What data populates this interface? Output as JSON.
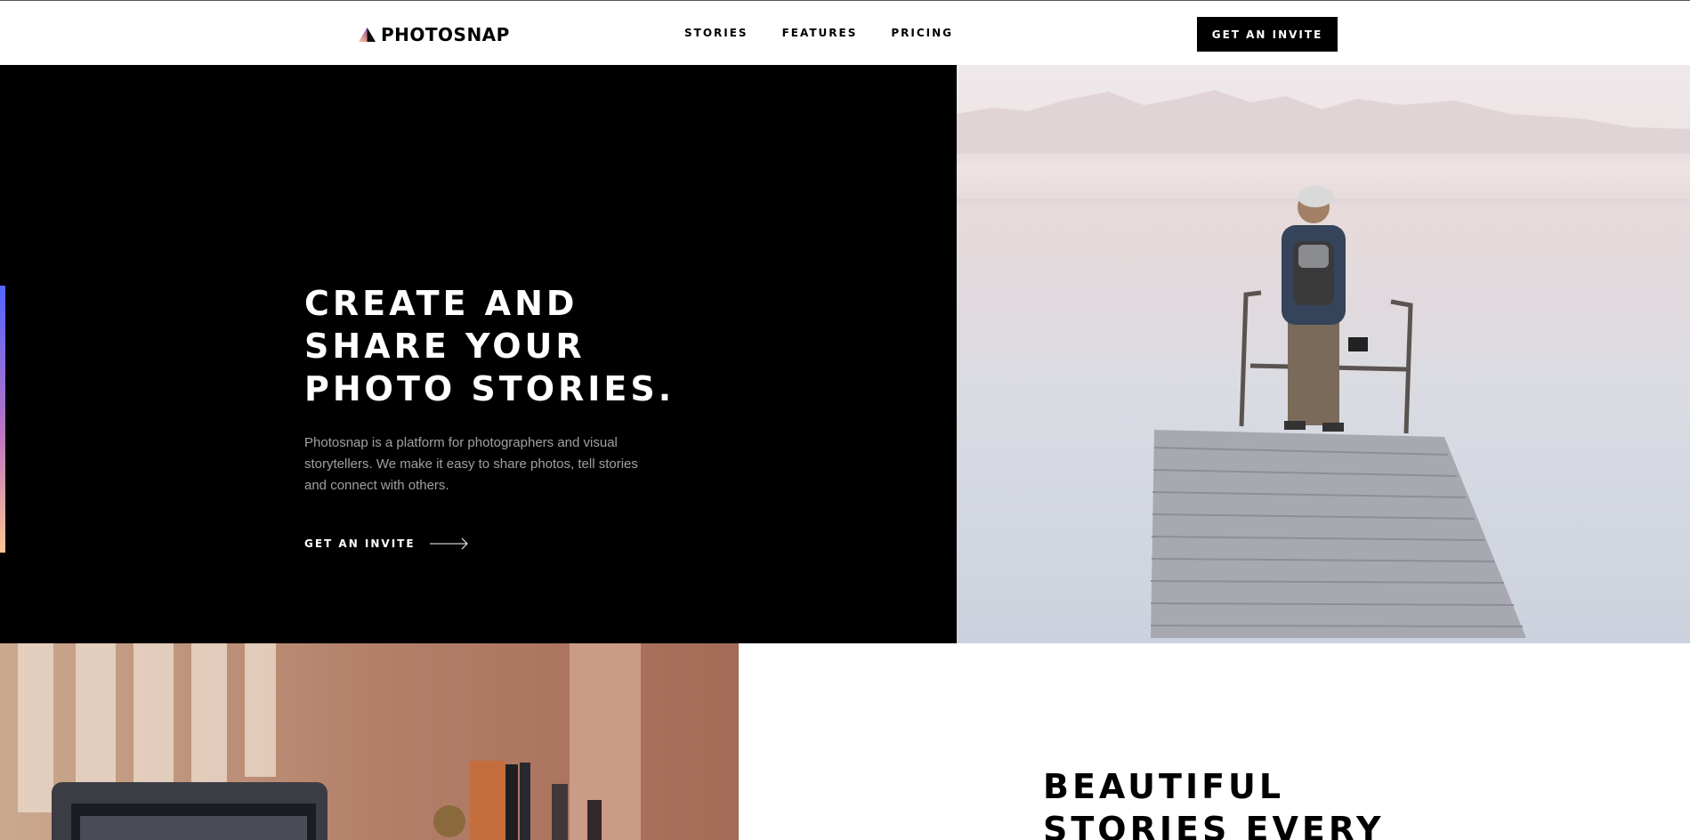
{
  "header": {
    "brand": "PHOTOSNAP",
    "logo_icon": "triangle-logo-icon",
    "nav": [
      {
        "label": "STORIES"
      },
      {
        "label": "FEATURES"
      },
      {
        "label": "PRICING"
      }
    ],
    "cta_label": "GET AN INVITE"
  },
  "hero": {
    "title_lines": [
      "CREATE AND",
      "SHARE YOUR",
      "PHOTO STORIES."
    ],
    "description": "Photosnap is a platform for photographers and visual storytellers. We make it easy to share photos, tell stories and connect with others.",
    "link_label": "GET AN INVITE",
    "link_icon": "arrow-right-icon"
  },
  "section2": {
    "title_lines": [
      "BEAUTIFUL",
      "STORIES EVERY"
    ]
  },
  "colors": {
    "background_dark": "#000000",
    "background_light": "#ffffff",
    "accent_gradient": [
      "#5165ff",
      "#bb74c1",
      "#ffc593"
    ]
  }
}
